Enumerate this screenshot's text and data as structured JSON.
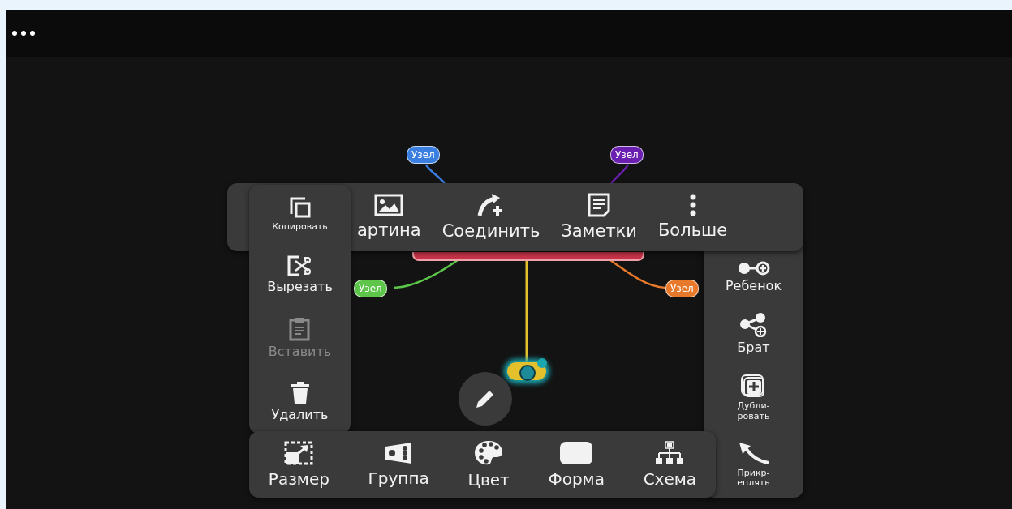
{
  "mind_map": {
    "nodes": [
      {
        "label": "Узел",
        "color": "#3a7ee0"
      },
      {
        "label": "Узел",
        "color": "#6a1fb0"
      },
      {
        "label": "Узел",
        "color": "#5cc54a"
      },
      {
        "label": "Узел",
        "color": "#e8792a"
      }
    ],
    "root_node": {
      "color": "#c9344a"
    },
    "selected_node": {
      "color": "#e4c12c",
      "selected": true
    }
  },
  "top_toolbar": [
    {
      "kind": "image",
      "label": "артина"
    },
    {
      "kind": "connect",
      "label": "Соединить"
    },
    {
      "kind": "notes",
      "label": "Заметки"
    },
    {
      "kind": "more",
      "label": "Больше"
    }
  ],
  "left_menu": [
    {
      "kind": "copy",
      "label": "Копировать",
      "disabled": false
    },
    {
      "kind": "cut",
      "label": "Вырезать",
      "disabled": false
    },
    {
      "kind": "paste",
      "label": "Вставить",
      "disabled": true
    },
    {
      "kind": "delete",
      "label": "Удалить",
      "disabled": false
    }
  ],
  "right_menu": [
    {
      "kind": "child",
      "label": "Ребенок"
    },
    {
      "kind": "sibling",
      "label": "Брат"
    },
    {
      "kind": "duplicate",
      "label": "Дубли-\nровать"
    },
    {
      "kind": "attach",
      "label": "Прикр-\nеплять"
    }
  ],
  "bottom_toolbar": [
    {
      "kind": "size",
      "label": "Размер"
    },
    {
      "kind": "group",
      "label": "Группа"
    },
    {
      "kind": "color",
      "label": "Цвет"
    },
    {
      "kind": "shape",
      "label": "Форма"
    },
    {
      "kind": "layout",
      "label": "Схема"
    }
  ]
}
